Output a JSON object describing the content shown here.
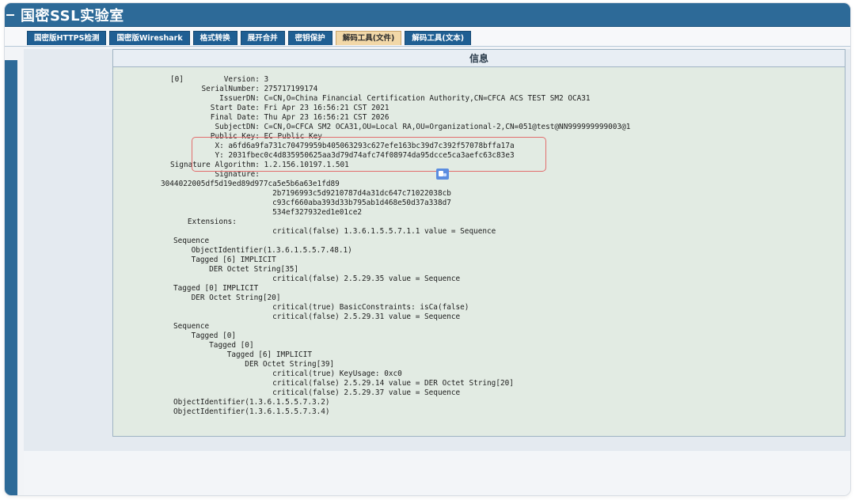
{
  "app": {
    "title": "国密SSL实验室",
    "tabs": [
      {
        "label": "国密版HTTPS检测",
        "active": false
      },
      {
        "label": "国密版Wireshark",
        "active": false
      },
      {
        "label": "格式转换",
        "active": false
      },
      {
        "label": "展开合并",
        "active": false
      },
      {
        "label": "密钥保护",
        "active": false
      },
      {
        "label": "解码工具(文件)",
        "active": true
      },
      {
        "label": "解码工具(文本)",
        "active": false
      }
    ]
  },
  "panel": {
    "header": "信息"
  },
  "output": [
    "[0]         Version: 3",
    "       SerialNumber: 275717199174",
    "           IssuerDN: C=CN,O=China Financial Certification Authority,CN=CFCA ACS TEST SM2 OCA31",
    "         Start Date: Fri Apr 23 16:56:21 CST 2021",
    "         Final Date: Thu Apr 23 16:56:21 CST 2026",
    "          SubjectDN: C=CN,O=CFCA SM2 OCA31,OU=Local RA,OU=Organizational-2,CN=051@test@NN999999999003@1",
    "         Public Key: EC Public Key",
    "          X: a6fd6a9fa731c70479959b405063293c627efe163bc39d7c392f57078bffa17a",
    "          Y: 2031fbec0c4d835950625aa3d79d74afc74f08974da95dcce5ca3aefc63c83e3",
    "Signature Algorithm: 1.2.156.10197.1.501",
    "          Signature:",
    "3044022005df5d19ed89d977ca5e5b6a63e1fd89",
    "                         2b7196993c5d9210787d4a31dc647c71022038cb",
    "                         c93cf660aba393d33b795ab1d468e50d37a338d7",
    "                         534ef327932ed1e01ce2",
    "      Extensions:",
    "                         critical(false) 1.3.6.1.5.5.7.1.1 value = Sequence",
    "Sequence",
    "    ObjectIdentifier(1.3.6.1.5.5.7.48.1)",
    "    Tagged [6] IMPLICIT",
    "        DER Octet String[35]",
    "                         critical(false) 2.5.29.35 value = Sequence",
    "Tagged [0] IMPLICIT",
    "    DER Octet String[20]",
    "                         critical(true) BasicConstraints: isCa(false)",
    "                         critical(false) 2.5.29.31 value = Sequence",
    "Sequence",
    "    Tagged [0]",
    "        Tagged [0]",
    "            Tagged [6] IMPLICIT",
    "                DER Octet String[39]",
    "                         critical(true) KeyUsage: 0xc0",
    "                         critical(false) 2.5.29.14 value = DER Octet String[20]",
    "                         critical(false) 2.5.29.37 value = Sequence",
    "ObjectIdentifier(1.3.6.1.5.5.7.3.2)",
    "ObjectIdentifier(1.3.6.1.5.5.7.3.4)"
  ],
  "colors": {
    "titlebar": "#2d6a98",
    "tab": "#1f5f93",
    "tab_active": "#f2d8a8",
    "highlight": "#e26d6d"
  }
}
